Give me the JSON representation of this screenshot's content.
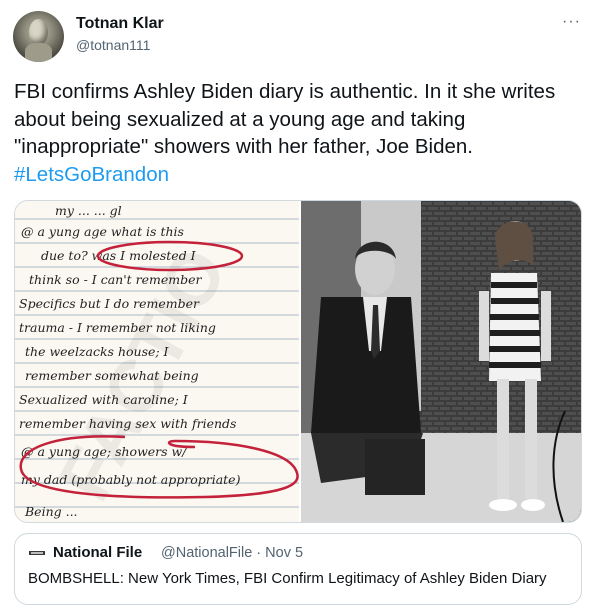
{
  "author": {
    "display_name": "Totnan Klar",
    "handle": "@totnan111"
  },
  "more_icon": "ellipsis-icon",
  "tweet": {
    "text": "FBI confirms Ashley Biden diary is authentic. In it she writes about being sexualized at a young age and taking \"inappropriate\" showers with her father, Joe Biden. ",
    "hashtag": "#LetsGoBrandon"
  },
  "colors": {
    "hashtag": "#1d9bf0",
    "secondary_text": "#536471",
    "border": "#cfd9de",
    "annotation": "#c4213a"
  },
  "media": {
    "diary_lines": [
      "my ... ... gl",
      "@ a yung age what is this",
      "due to? was I molested I",
      "think so - I can't remember",
      "Specifics but I do remember",
      "trauma - I remember not liking",
      "the weelzacks house; I",
      "remember somewhat being",
      "Sexualized with caroline; I",
      "remember having sex with friends",
      "@ a yung age; showers w/",
      "my dad (probably not appropriate)",
      "Being ..."
    ],
    "watermark": "FACTIO"
  },
  "quoted": {
    "display_name": "National File",
    "handle_date": "@NationalFile · Nov 5",
    "text": "BOMBSHELL: New York Times, FBI Confirm Legitimacy of Ashley Biden Diary"
  }
}
